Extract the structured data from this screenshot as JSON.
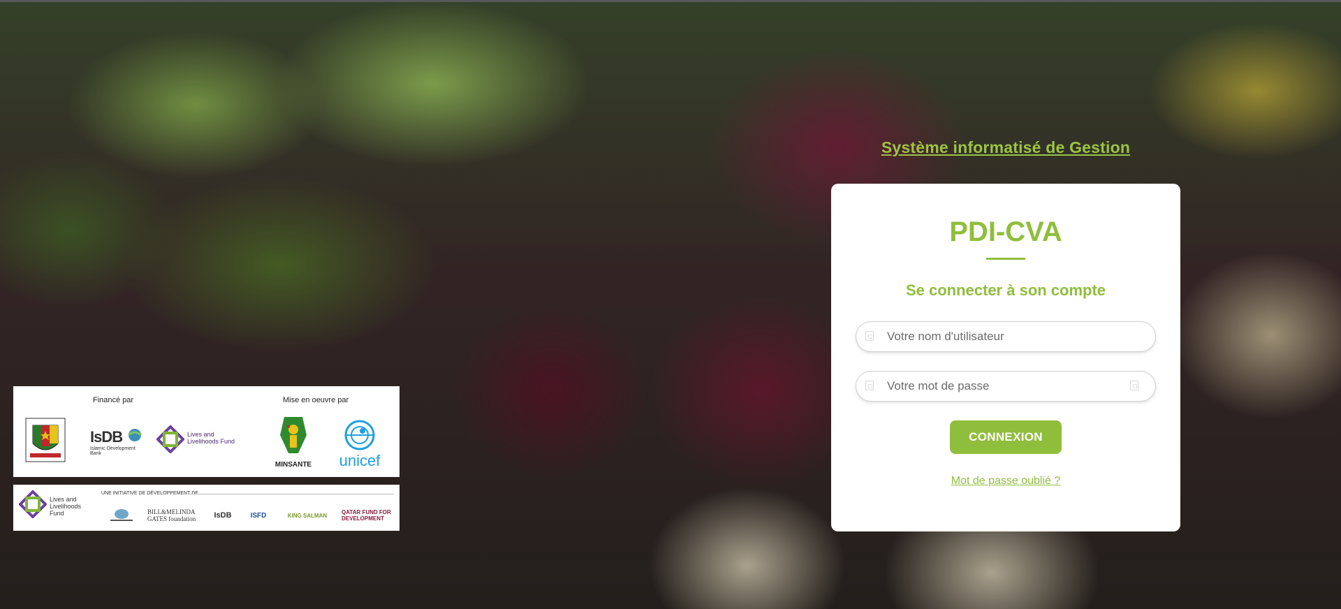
{
  "header": {
    "system_title": "Système informatisé de Gestion"
  },
  "login": {
    "app_title": "PDI-CVA",
    "subtitle": "Se connecter à son compte",
    "username_placeholder": "Votre nom d'utilisateur",
    "password_placeholder": "Votre mot de passe",
    "submit_label": "CONNEXION",
    "forgot_label": "Mot de passe oublié ?"
  },
  "sponsors": {
    "funded_by_label": "Financé par",
    "implemented_by_label": "Mise en oeuvre par",
    "isdb_mark": "IsDB",
    "isdb_subtitle": "Islamic Development Bank",
    "llf_name": "Lives and Livelihoods Fund",
    "minsante_name": "MINSANTE",
    "unicef_name": "unicef",
    "initiative_label": "UNE INITIATIVE DE DÉVELOPPEMENT DE",
    "partners": [
      "",
      "BILL&MELINDA GATES foundation",
      "IsDB",
      "ISFD",
      "KING SALMAN",
      "QATAR FUND FOR DEVELOPMENT"
    ]
  },
  "colors": {
    "accent": "#8fbe3c",
    "title_accent": "#9dc444",
    "unicef_blue": "#1ca0e0",
    "llf_purple": "#4b2a73"
  },
  "icons": {
    "username": "user-icon",
    "password": "lock-icon",
    "password_toggle": "eye-icon"
  }
}
